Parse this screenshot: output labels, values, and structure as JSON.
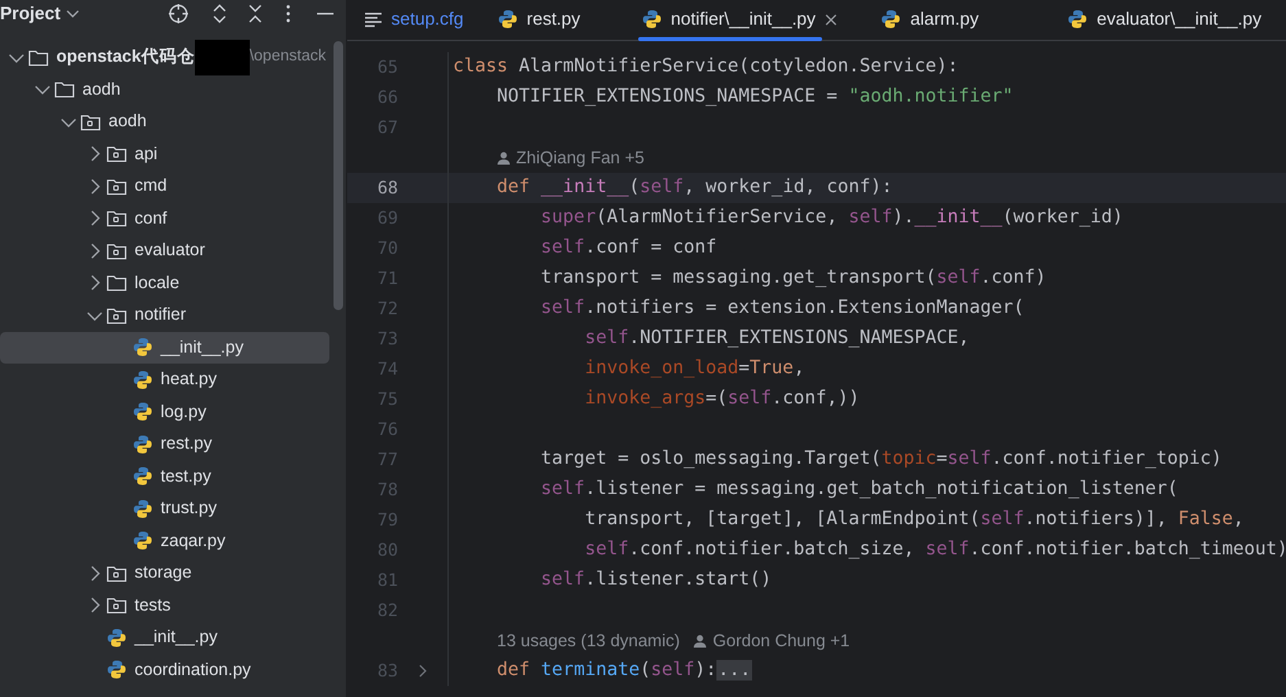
{
  "project_panel": {
    "title": "Project",
    "tree": [
      {
        "kind": "folder",
        "label": "openstack代码仓",
        "path_hint": "\\openstack",
        "redacted": true,
        "expanded": true,
        "selected": false,
        "children": [
          {
            "kind": "folder",
            "label": "aodh",
            "expanded": true,
            "selected": false,
            "children": [
              {
                "kind": "package",
                "label": "aodh",
                "expanded": true,
                "selected": false,
                "children": [
                  {
                    "kind": "package",
                    "label": "api",
                    "expanded": false,
                    "selected": false
                  },
                  {
                    "kind": "package",
                    "label": "cmd",
                    "expanded": false,
                    "selected": false
                  },
                  {
                    "kind": "package",
                    "label": "conf",
                    "expanded": false,
                    "selected": false
                  },
                  {
                    "kind": "package",
                    "label": "evaluator",
                    "expanded": false,
                    "selected": false
                  },
                  {
                    "kind": "folder",
                    "label": "locale",
                    "expanded": false,
                    "selected": false
                  },
                  {
                    "kind": "package",
                    "label": "notifier",
                    "expanded": true,
                    "selected": false,
                    "children": [
                      {
                        "kind": "python",
                        "label": "__init__.py",
                        "selected": true
                      },
                      {
                        "kind": "python",
                        "label": "heat.py",
                        "selected": false
                      },
                      {
                        "kind": "python",
                        "label": "log.py",
                        "selected": false
                      },
                      {
                        "kind": "python",
                        "label": "rest.py",
                        "selected": false
                      },
                      {
                        "kind": "python",
                        "label": "test.py",
                        "selected": false
                      },
                      {
                        "kind": "python",
                        "label": "trust.py",
                        "selected": false
                      },
                      {
                        "kind": "python",
                        "label": "zaqar.py",
                        "selected": false
                      }
                    ]
                  },
                  {
                    "kind": "package",
                    "label": "storage",
                    "expanded": false,
                    "selected": false
                  },
                  {
                    "kind": "package",
                    "label": "tests",
                    "expanded": false,
                    "selected": false
                  },
                  {
                    "kind": "python",
                    "label": "__init__.py",
                    "selected": false
                  },
                  {
                    "kind": "python",
                    "label": "coordination.py",
                    "selected": false
                  }
                ]
              }
            ]
          }
        ]
      }
    ]
  },
  "tabs": [
    {
      "kind": "config",
      "label": "setup.cfg",
      "selected": false,
      "color": "#548af7"
    },
    {
      "kind": "python",
      "label": "rest.py",
      "selected": false,
      "color": "#dfe1e5"
    },
    {
      "kind": "python",
      "label": "notifier\\__init__.py",
      "selected": true,
      "color": "#dfe1e5"
    },
    {
      "kind": "python",
      "label": "alarm.py",
      "selected": false,
      "color": "#dfe1e5"
    },
    {
      "kind": "python",
      "label": "evaluator\\__init__.py",
      "selected": false,
      "color": "#dfe1e5"
    }
  ],
  "editor": {
    "lines": [
      {
        "kind": "code",
        "number": "65",
        "current": false,
        "tokens": [
          {
            "kind": "keyword",
            "text": "class "
          },
          {
            "kind": "plain",
            "text": "AlarmNotifierService(cotyledon.Service):"
          }
        ]
      },
      {
        "kind": "code",
        "number": "66",
        "current": false,
        "tokens": [
          {
            "kind": "plain",
            "text": "    NOTIFIER_EXTENSIONS_NAMESPACE = "
          },
          {
            "kind": "string",
            "text": "\"aodh.notifier\""
          }
        ]
      },
      {
        "kind": "code",
        "number": "67",
        "current": false
      },
      {
        "kind": "hint",
        "parts": [
          {
            "kind": "author",
            "text": "ZhiQiang Fan +5"
          }
        ]
      },
      {
        "kind": "code",
        "number": "68",
        "current": true,
        "tokens": [
          {
            "kind": "keyword",
            "text": "    def "
          },
          {
            "kind": "magic",
            "text": "__init__"
          },
          {
            "kind": "plain",
            "text": "("
          },
          {
            "kind": "self",
            "text": "self"
          },
          {
            "kind": "plain",
            "text": ", worker_id, conf):"
          }
        ]
      },
      {
        "kind": "code",
        "number": "69",
        "current": false,
        "tokens": [
          {
            "kind": "self",
            "text": "        super"
          },
          {
            "kind": "plain",
            "text": "(AlarmNotifierService, "
          },
          {
            "kind": "self",
            "text": "self"
          },
          {
            "kind": "plain",
            "text": ")."
          },
          {
            "kind": "magic",
            "text": "__init__"
          },
          {
            "kind": "plain",
            "text": "(worker_id)"
          }
        ]
      },
      {
        "kind": "code",
        "number": "70",
        "current": false,
        "tokens": [
          {
            "kind": "self",
            "text": "        self"
          },
          {
            "kind": "plain",
            "text": ".conf = conf"
          }
        ]
      },
      {
        "kind": "code",
        "number": "71",
        "current": false,
        "tokens": [
          {
            "kind": "plain",
            "text": "        transport = messaging.get_transport("
          },
          {
            "kind": "self",
            "text": "self"
          },
          {
            "kind": "plain",
            "text": ".conf)"
          }
        ]
      },
      {
        "kind": "code",
        "number": "72",
        "current": false,
        "tokens": [
          {
            "kind": "self",
            "text": "        self"
          },
          {
            "kind": "plain",
            "text": ".notifiers = extension.ExtensionManager("
          }
        ]
      },
      {
        "kind": "code",
        "number": "73",
        "current": false,
        "tokens": [
          {
            "kind": "self",
            "text": "            self"
          },
          {
            "kind": "plain",
            "text": ".NOTIFIER_EXTENSIONS_NAMESPACE,"
          }
        ]
      },
      {
        "kind": "code",
        "number": "74",
        "current": false,
        "tokens": [
          {
            "kind": "param",
            "text": "            invoke_on_load"
          },
          {
            "kind": "plain",
            "text": "="
          },
          {
            "kind": "keyword",
            "text": "True"
          },
          {
            "kind": "plain",
            "text": ","
          }
        ]
      },
      {
        "kind": "code",
        "number": "75",
        "current": false,
        "tokens": [
          {
            "kind": "param",
            "text": "            invoke_args"
          },
          {
            "kind": "plain",
            "text": "=("
          },
          {
            "kind": "self",
            "text": "self"
          },
          {
            "kind": "plain",
            "text": ".conf,))"
          }
        ]
      },
      {
        "kind": "code",
        "number": "76",
        "current": false
      },
      {
        "kind": "code",
        "number": "77",
        "current": false,
        "tokens": [
          {
            "kind": "plain",
            "text": "        target = oslo_messaging.Target("
          },
          {
            "kind": "param",
            "text": "topic"
          },
          {
            "kind": "plain",
            "text": "="
          },
          {
            "kind": "self",
            "text": "self"
          },
          {
            "kind": "plain",
            "text": ".conf.notifier_topic)"
          }
        ]
      },
      {
        "kind": "code",
        "number": "78",
        "current": false,
        "tokens": [
          {
            "kind": "self",
            "text": "        self"
          },
          {
            "kind": "plain",
            "text": ".listener = messaging.get_batch_notification_listener("
          }
        ]
      },
      {
        "kind": "code",
        "number": "79",
        "current": false,
        "tokens": [
          {
            "kind": "plain",
            "text": "            transport, [target], [AlarmEndpoint("
          },
          {
            "kind": "self",
            "text": "self"
          },
          {
            "kind": "plain",
            "text": ".notifiers)], "
          },
          {
            "kind": "keyword",
            "text": "False"
          },
          {
            "kind": "plain",
            "text": ","
          }
        ]
      },
      {
        "kind": "code",
        "number": "80",
        "current": false,
        "tokens": [
          {
            "kind": "self",
            "text": "            self"
          },
          {
            "kind": "plain",
            "text": ".conf.notifier.batch_size, "
          },
          {
            "kind": "self",
            "text": "self"
          },
          {
            "kind": "plain",
            "text": ".conf.notifier.batch_timeout)"
          }
        ]
      },
      {
        "kind": "code",
        "number": "81",
        "current": false,
        "tokens": [
          {
            "kind": "self",
            "text": "        self"
          },
          {
            "kind": "plain",
            "text": ".listener.start()"
          }
        ]
      },
      {
        "kind": "code",
        "number": "82",
        "current": false
      },
      {
        "kind": "hint",
        "parts": [
          {
            "kind": "usages",
            "text": "13 usages (13 dynamic)"
          },
          {
            "kind": "author",
            "text": "Gordon Chung +1"
          }
        ]
      },
      {
        "kind": "code",
        "number": "83",
        "current": false,
        "folded": true,
        "tokens": [
          {
            "kind": "keyword",
            "text": "    def "
          },
          {
            "kind": "funcname",
            "text": "terminate"
          },
          {
            "kind": "plain",
            "text": "("
          },
          {
            "kind": "self",
            "text": "self"
          },
          {
            "kind": "plain",
            "text": "):"
          },
          {
            "kind": "fold",
            "text": "..."
          }
        ]
      }
    ]
  }
}
